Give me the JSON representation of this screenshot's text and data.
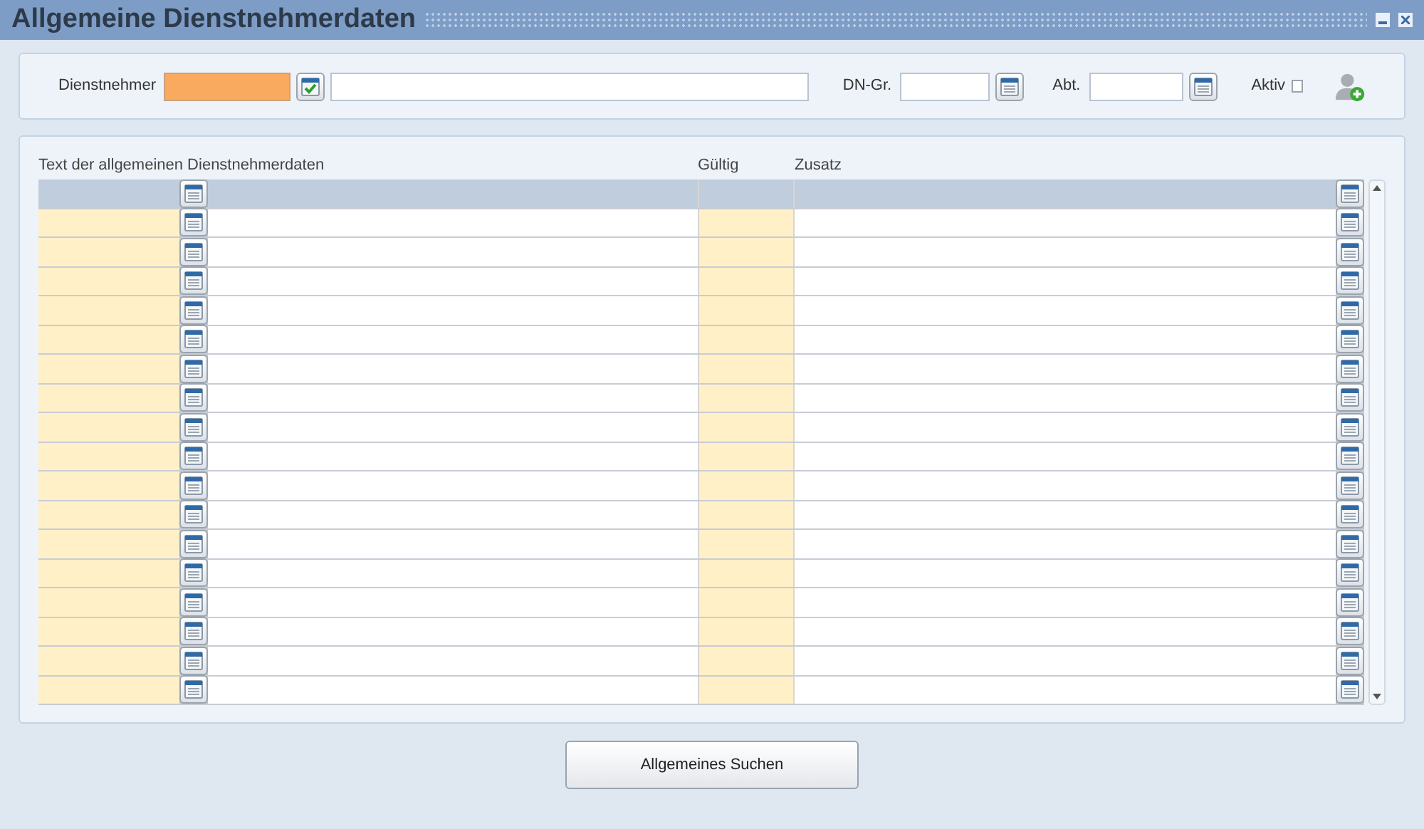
{
  "window": {
    "title": "Allgemeine Dienstnehmerdaten"
  },
  "filter": {
    "employee_label": "Dienstnehmer",
    "group_label": "DN-Gr.",
    "department_label": "Abt.",
    "active_label": "Aktiv",
    "active_checked": false
  },
  "table": {
    "columns": [
      "Text der allgemeinen Dienstnehmerdaten",
      "Gültig",
      "Zusatz"
    ],
    "rows": [
      {
        "selected": true
      },
      {
        "selected": false
      },
      {
        "selected": false
      },
      {
        "selected": false
      },
      {
        "selected": false
      },
      {
        "selected": false
      },
      {
        "selected": false
      },
      {
        "selected": false
      },
      {
        "selected": false
      },
      {
        "selected": false
      },
      {
        "selected": false
      },
      {
        "selected": false
      },
      {
        "selected": false
      },
      {
        "selected": false
      },
      {
        "selected": false
      },
      {
        "selected": false
      },
      {
        "selected": false
      },
      {
        "selected": false
      }
    ]
  },
  "buttons": [
    "Allgemeines Suchen"
  ]
}
